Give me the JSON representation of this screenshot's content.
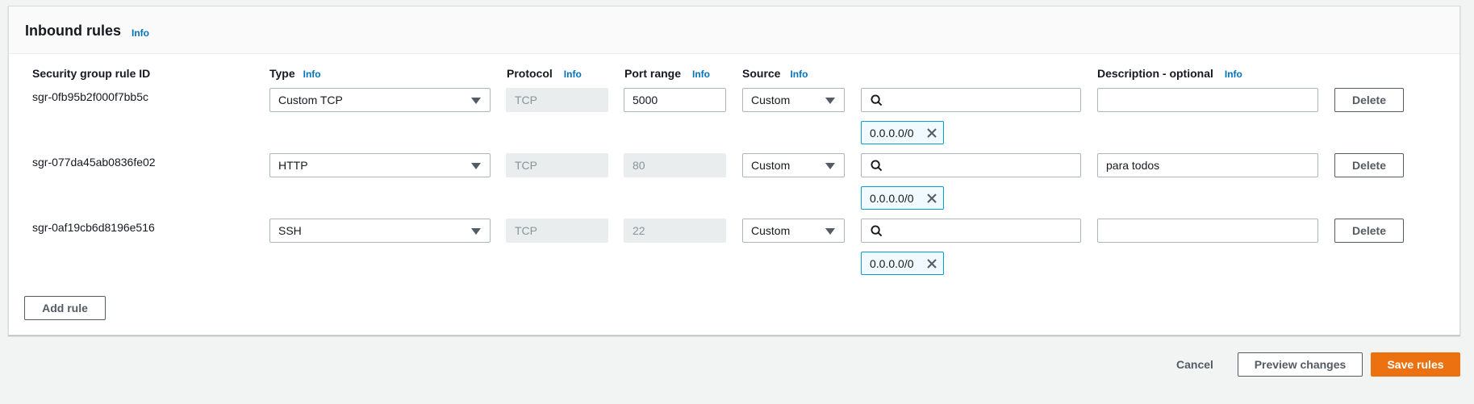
{
  "panel": {
    "title": "Inbound rules",
    "info": "Info"
  },
  "columns": {
    "rule_id": "Security group rule ID",
    "type": "Type",
    "protocol": "Protocol",
    "port_range": "Port range",
    "source": "Source",
    "description": "Description - optional",
    "info": "Info"
  },
  "rules": [
    {
      "id": "sgr-0fb95b2f000f7bb5c",
      "type": "Custom TCP",
      "protocol": "TCP",
      "port_range": "5000",
      "source": "Custom",
      "search_value": "",
      "cidr": "0.0.0.0/0",
      "description": "",
      "delete_label": "Delete"
    },
    {
      "id": "sgr-077da45ab0836fe02",
      "type": "HTTP",
      "protocol": "TCP",
      "port_range": "80",
      "source": "Custom",
      "search_value": "",
      "cidr": "0.0.0.0/0",
      "description": "para todos",
      "delete_label": "Delete"
    },
    {
      "id": "sgr-0af19cb6d8196e516",
      "type": "SSH",
      "protocol": "TCP",
      "port_range": "22",
      "source": "Custom",
      "search_value": "",
      "cidr": "0.0.0.0/0",
      "description": "",
      "delete_label": "Delete"
    }
  ],
  "actions": {
    "add_rule": "Add rule",
    "cancel": "Cancel",
    "preview": "Preview changes",
    "save": "Save rules"
  },
  "colors": {
    "accent": "#ec7211",
    "link": "#0073bb",
    "token_border": "#00a1c9"
  }
}
